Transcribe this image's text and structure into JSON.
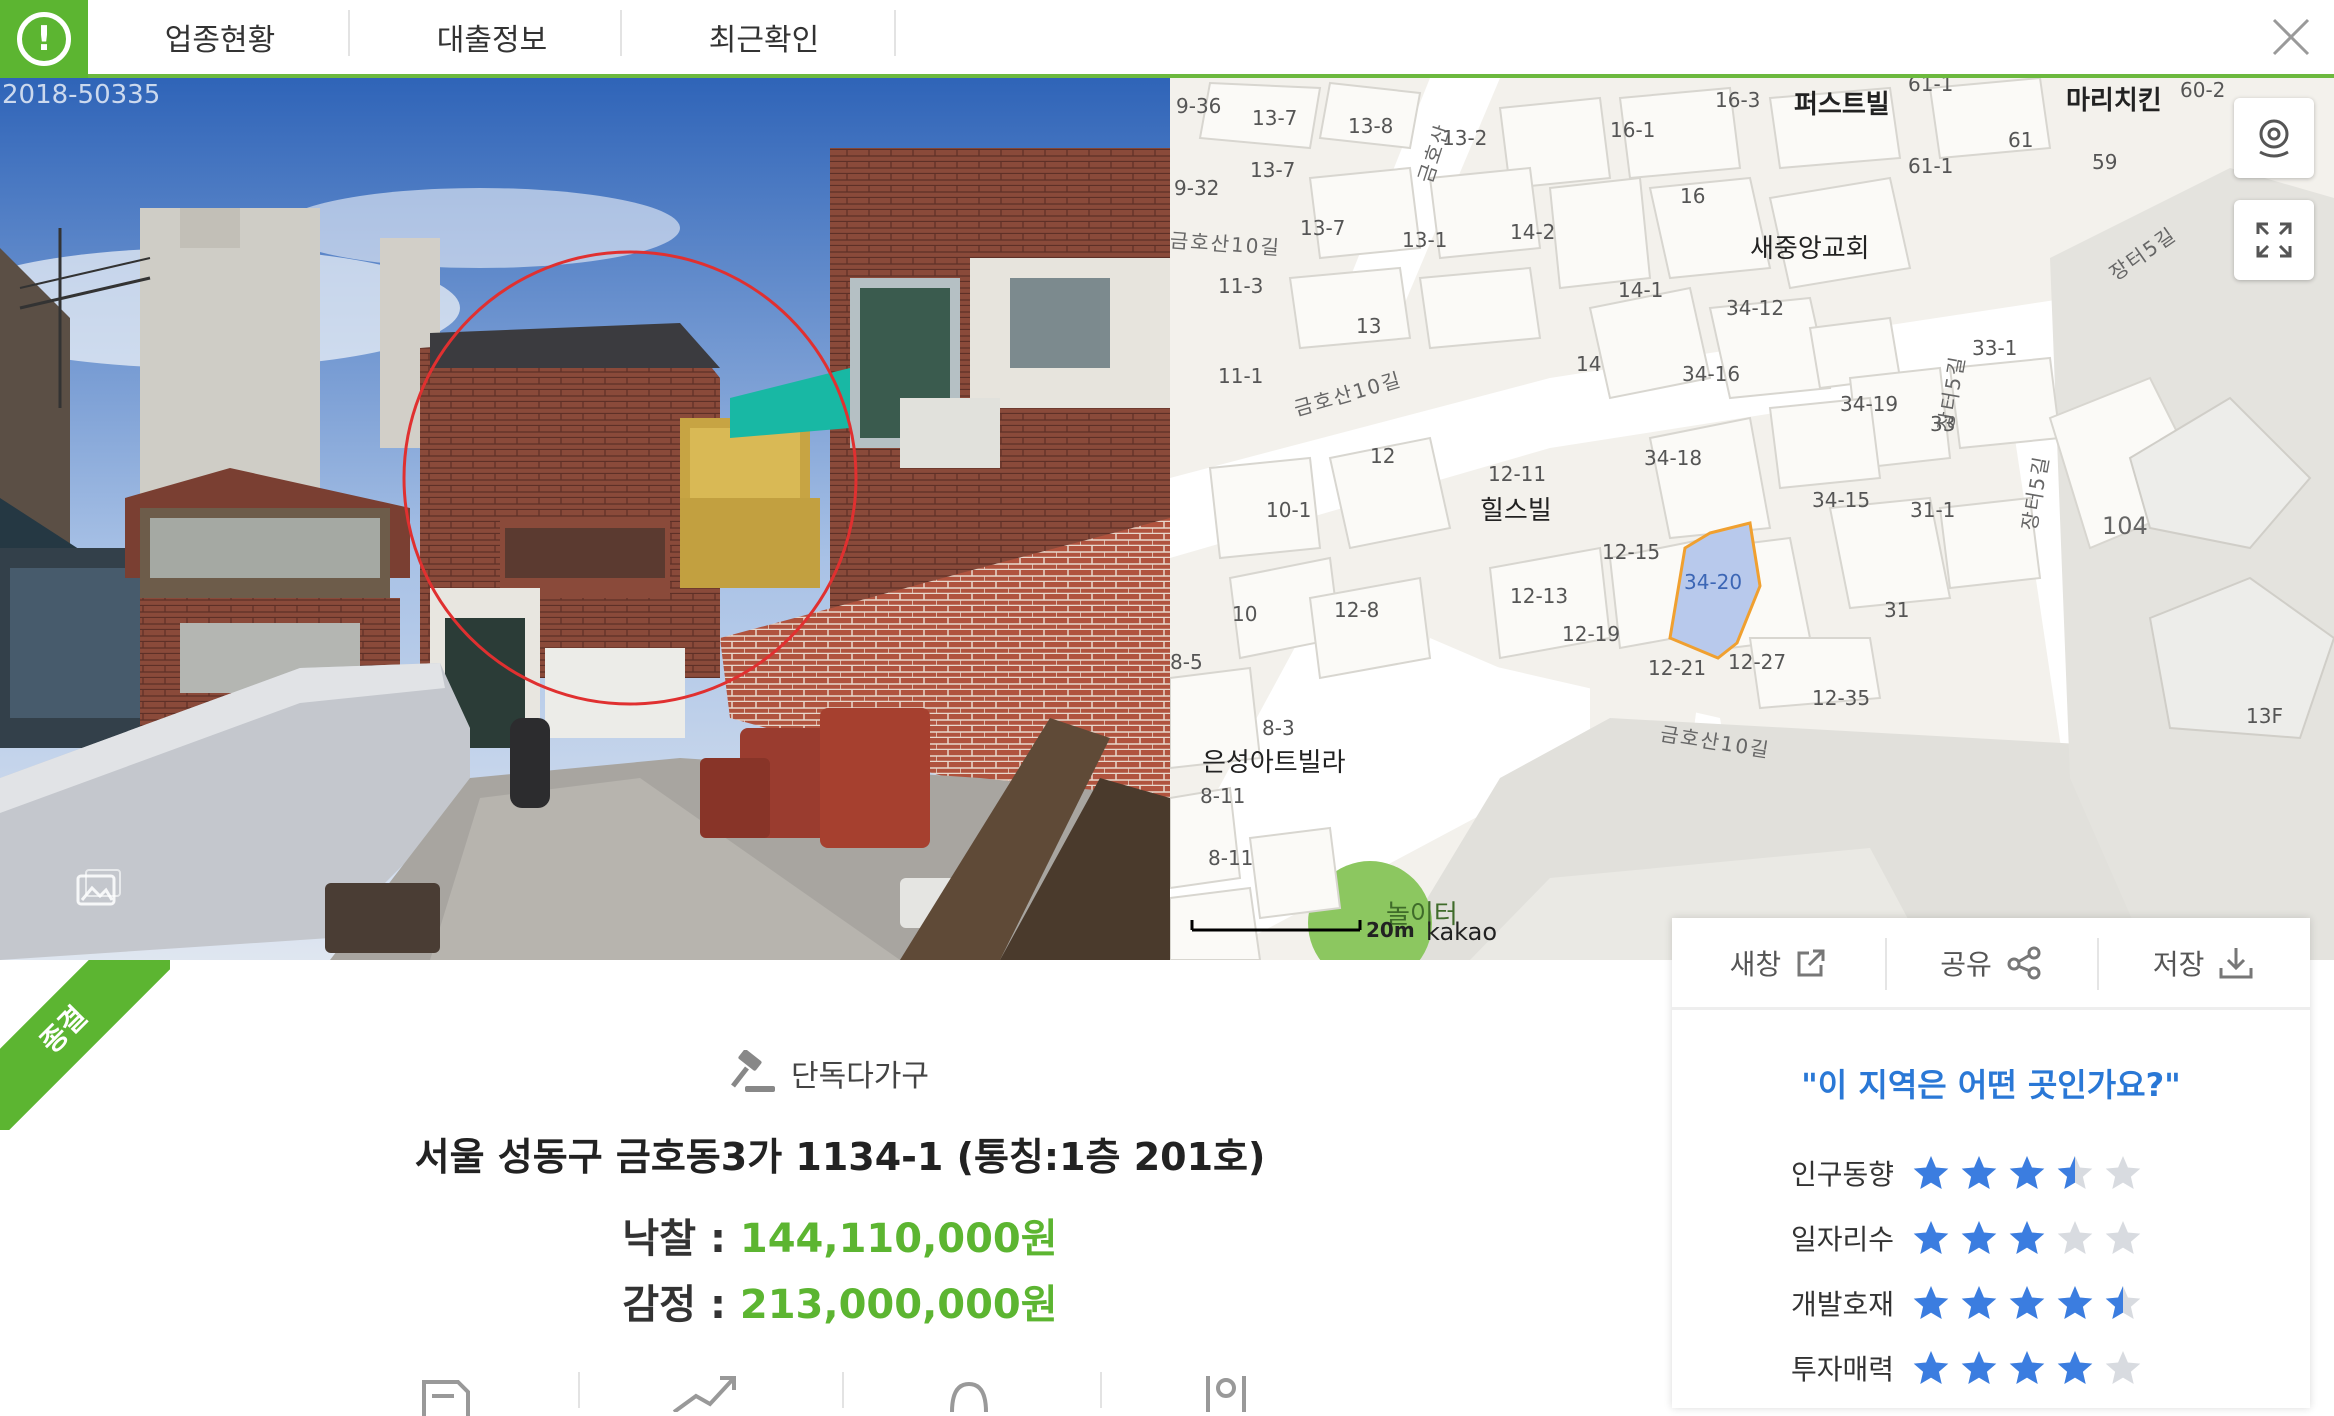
{
  "topbar": {
    "alert_icon": "exclamation-icon",
    "tabs": [
      {
        "label": "업종현황"
      },
      {
        "label": "대출정보"
      },
      {
        "label": "최근확인"
      }
    ],
    "close_icon": "close-icon"
  },
  "photo": {
    "watermark": "2018-50335"
  },
  "map": {
    "places": [
      "퍼스트빌",
      "마리치킨",
      "새중앙교회",
      "힐스빌",
      "은성아트빌라",
      "놀이터"
    ],
    "roads": [
      "금호산10길",
      "금호산10길",
      "금호산10길",
      "장터5길",
      "장터5길",
      "장터5길",
      "금호산"
    ],
    "lots": [
      "9-36",
      "13-7",
      "13-8",
      "13-2",
      "16-3",
      "61-1",
      "60-2",
      "16-1",
      "61",
      "59",
      "61-1",
      "13-7",
      "9-32",
      "13-7",
      "13-1",
      "16",
      "14-2",
      "11-3",
      "14-1",
      "34-12",
      "13",
      "11-1",
      "14",
      "34-16",
      "33-1",
      "34-19",
      "33",
      "12",
      "12-11",
      "34-18",
      "10-1",
      "34-15",
      "31-1",
      "104",
      "12-15",
      "34-20",
      "10",
      "12-8",
      "12-13",
      "31",
      "12-19",
      "8-5",
      "12-21",
      "12-27",
      "12-35",
      "8-3",
      "13F",
      "8-11",
      "8-11"
    ],
    "scale": "20m",
    "brand": "kakao"
  },
  "listing": {
    "status": "종결",
    "category": "단독다가구",
    "address": "서울 성동구 금호동3가 1134-1 (통칭:1층 201호)",
    "winning_bid_label": "낙찰 : ",
    "winning_bid": "144,110,000원",
    "appraisal_label": "감정 : ",
    "appraisal": "213,000,000원"
  },
  "panel": {
    "buttons": [
      {
        "label": "새창",
        "icon": "external-link-icon"
      },
      {
        "label": "공유",
        "icon": "share-icon"
      },
      {
        "label": "저장",
        "icon": "download-icon"
      }
    ],
    "question": "\"이 지역은 어떤 곳인가요?\"",
    "ratings": [
      {
        "label": "인구동향",
        "score": 3.5
      },
      {
        "label": "일자리수",
        "score": 3
      },
      {
        "label": "개발호재",
        "score": 4.5
      },
      {
        "label": "투자매력",
        "score": 4
      }
    ],
    "colors": {
      "star_on": "#3b7de0",
      "star_off": "#d8dbe0"
    }
  },
  "colors": {
    "brand_green": "#5cb531",
    "link_blue": "#2a78d6"
  }
}
